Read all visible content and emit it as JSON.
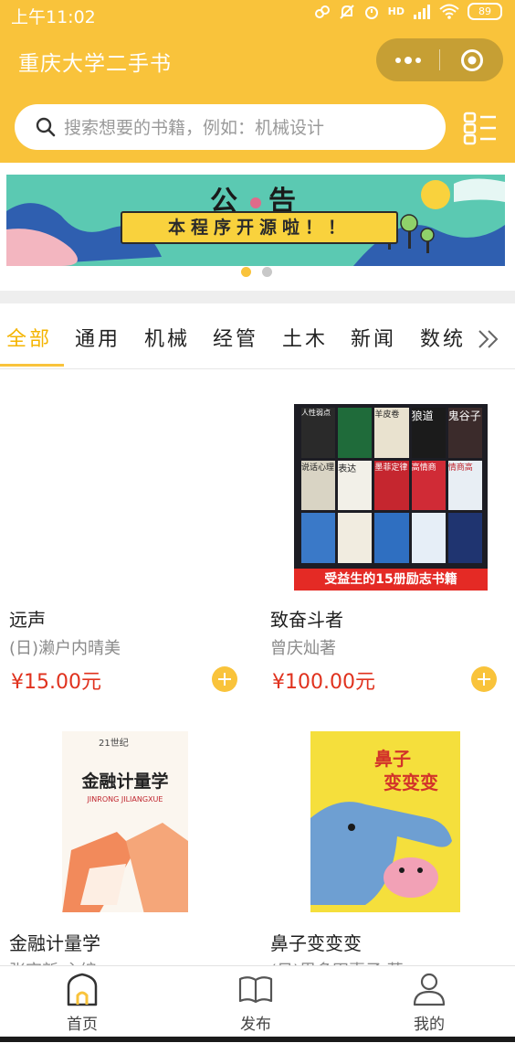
{
  "status_bar": {
    "time": "上午11:02",
    "signal_label": "HD",
    "battery": "89"
  },
  "header": {
    "title": "重庆大学二手书",
    "search_placeholder": "搜索想要的书籍，例如：机械设计"
  },
  "banner": {
    "title_left": "公",
    "title_right": "告",
    "subtitle": "本程序开源啦！！",
    "active_slide": 1,
    "slide_count": 2
  },
  "categories": {
    "items": [
      "全部",
      "通用",
      "机械",
      "经管",
      "土木",
      "新闻",
      "数统"
    ],
    "active": "全部"
  },
  "products": [
    {
      "title": "远声",
      "author": "(日)濑户内晴美",
      "price": "¥15.00元"
    },
    {
      "title": "致奋斗者",
      "author": "曾庆灿著",
      "price": "¥100.00元",
      "cover_banner": "受益生的15册励志书籍",
      "cover_spines": [
        "人性弱点",
        "羊皮卷",
        "狼道",
        "鬼谷子",
        "说话心理",
        "表达",
        "墨菲定律",
        "高情商",
        "情商高"
      ]
    },
    {
      "title": "金融计量学",
      "author": "张宏新 主编",
      "price": "",
      "cover_series": "21世纪",
      "cover_title": "金融计量学",
      "cover_pinyin": "JINRONG JILIANGXUE"
    },
    {
      "title": "鼻子变变变",
      "author": "(日)里多田惠子 著",
      "price": "",
      "cover_title_a": "鼻子",
      "cover_title_b": "变变变"
    }
  ],
  "tabbar": {
    "home": "首页",
    "publish": "发布",
    "mine": "我的",
    "active": "首页"
  },
  "colors": {
    "brand": "#f9c33b",
    "price": "#e0321e",
    "accent_text": "#f4b400"
  }
}
